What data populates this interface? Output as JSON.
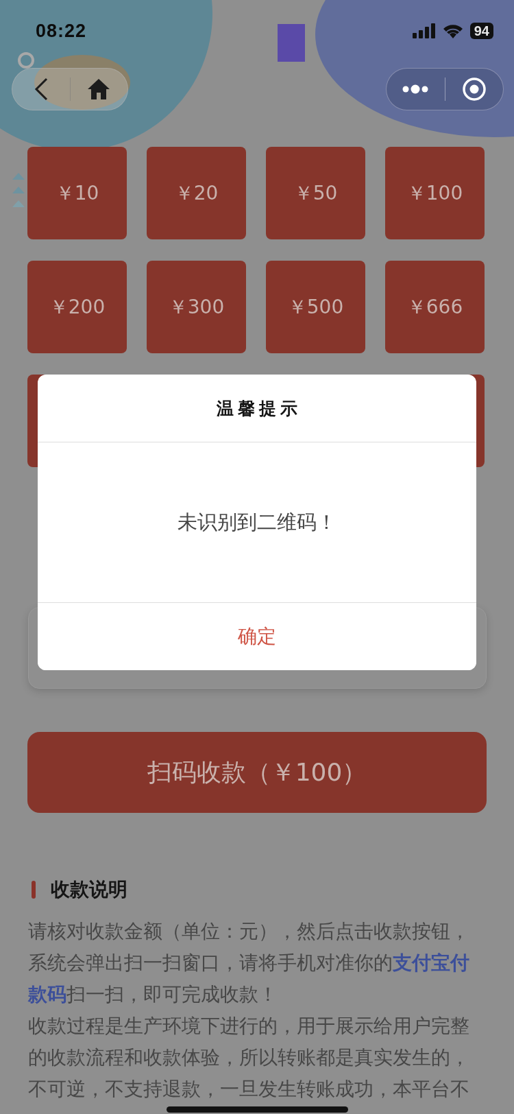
{
  "status_bar": {
    "time": "08:22",
    "battery": "94"
  },
  "amounts": [
    "￥10",
    "￥20",
    "￥50",
    "￥100",
    "￥200",
    "￥300",
    "￥500",
    "￥666"
  ],
  "pay_button": "扫码收款（￥100）",
  "notice": {
    "title": "收款说明",
    "paragraphs": [
      "请核对收款金额（单位：元），然后点击收款按钮，系统会弹出扫一扫窗口，请将手机对准你的**支付宝付款码**扫一扫，即可完成收款！",
      "收款过程是生产环境下进行的，用于展示给用户完整的收款流程和收款体验，所以转账都是真实发生的，不可逆，不支持退款，一旦发生转账成功，本平台不"
    ]
  },
  "dialog": {
    "title": "温馨提示",
    "message": "未识别到二维码！",
    "button": "确定"
  }
}
